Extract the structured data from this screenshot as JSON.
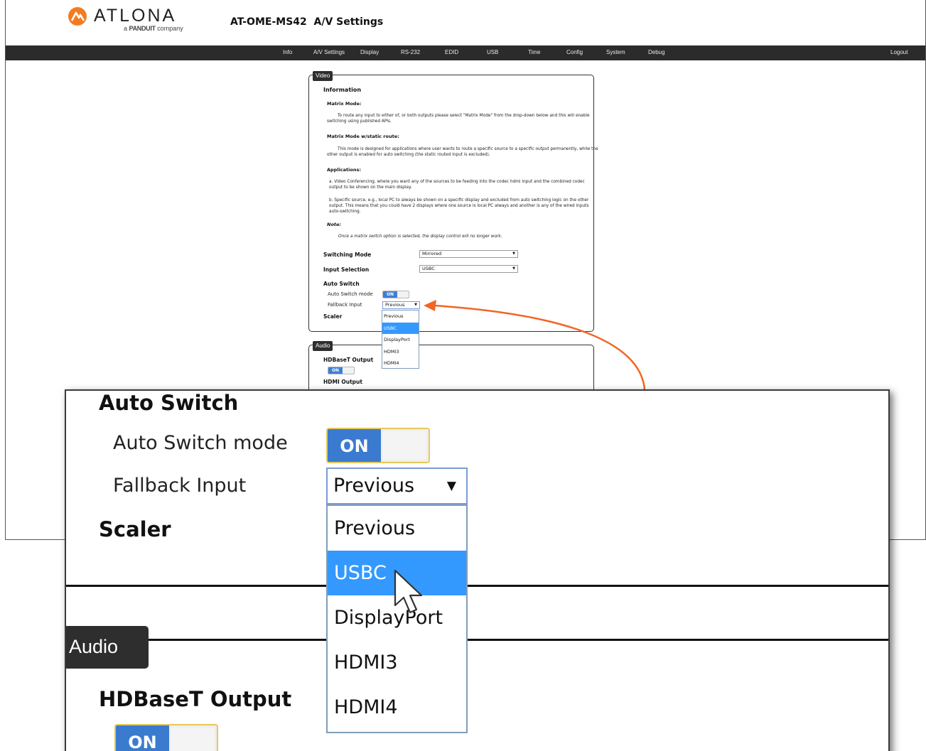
{
  "app": {
    "brand": "ATLONA",
    "brand_sub_prefix": "a",
    "brand_sub_bold": "PANDUIT",
    "brand_sub_suffix": "company",
    "title": "AT-OME-MS42  A/V Settings"
  },
  "nav": {
    "items": [
      "Info",
      "A/V Settings",
      "Display",
      "RS-232",
      "EDID",
      "USB",
      "Time",
      "Config",
      "System",
      "Debug"
    ],
    "logout": "Logout"
  },
  "video": {
    "legend": "Video",
    "information_heading": "Information",
    "matrix_mode_heading": "Matrix Mode:",
    "matrix_mode_text": "To route any input to either of, or both outputs please select \"Matrix Mode\" from the drop-down below and this will enable switching using published APIs.",
    "static_route_heading": "Matrix Mode w/static route:",
    "static_route_text": "This mode is designed for applications where user wants to route a specific source to a specific output permanently, while the other output is enabled for auto switching (the static routed input is excluded).",
    "applications_heading": "Applications:",
    "application_a": "a.  Video Conferencing, where you want any of the sources to be feeding into the codec hdmi input and the combined codec output to be shown on the main display.",
    "application_b": "b.  Specific source, e.g., local PC to always be shown on a specific display and excluded from auto switching logic on the other output. This means that you could have 2 displays where one source is local PC always and another is any of the wired inputs auto-switching.",
    "note_heading": "Note:",
    "note_text": "Once a matrix switch option is selected, the display control will no longer work.",
    "switching_mode_label": "Switching Mode",
    "switching_mode_value": "Mirrored",
    "input_selection_label": "Input Selection",
    "input_selection_value": "USBC",
    "auto_switch_heading": "Auto Switch",
    "auto_switch_mode_label": "Auto Switch mode",
    "auto_switch_mode_state": "ON",
    "fallback_input_label": "Fallback Input",
    "fallback_input_value": "Previous",
    "fallback_options": [
      "Previous",
      "USBC",
      "DisplayPort",
      "HDMI3",
      "HDMI4"
    ],
    "fallback_highlighted": "USBC",
    "scaler_heading": "Scaler"
  },
  "audio": {
    "legend": "Audio",
    "hdbaset_output_label": "HDBaseT Output",
    "hdbaset_output_state": "ON",
    "hdmi_output_label": "HDMI Output"
  },
  "arrow": "pointer",
  "colors": {
    "navbar": "#2b2b2b",
    "toggle_on": "#3a7bd0",
    "selection": "#3399ff",
    "callout_arrow": "#f26522",
    "logo_orange": "#f47b20"
  }
}
